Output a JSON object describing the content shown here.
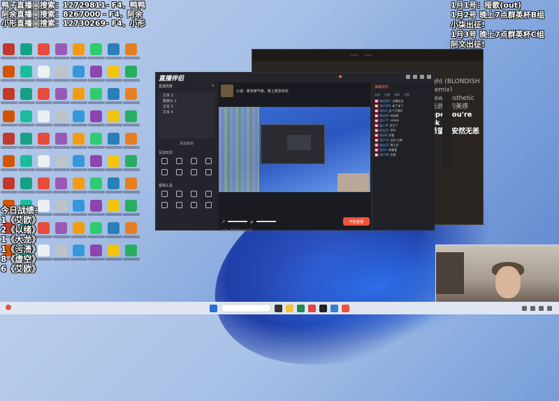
{
  "overlay_left": [
    "鸭子直播间搜索：12729811- F4、鸭鸭",
    "阿余直播间搜索：8267000 - F4、阿余",
    "小形直播间搜索：12730269- F4、小形"
  ],
  "overlay_right": [
    "1月1号：哑歌(out)",
    "1月2号 晚上7点群英杯B组",
    "小柒出征!",
    "1月3号 晚上7点群英杯C组",
    "阿文出征!"
  ],
  "score": {
    "title": "今日战绩：",
    "lines": [
      "1《艾欧》",
      "2《以绪》",
      "1《大龙》",
      "1《污渍》",
      "8《虚空》",
      "6《艾欧》"
    ]
  },
  "colors": {
    "accent": "#f0533a",
    "desktop_bg": "#a7c0e6",
    "app_bg": "#1f2026"
  },
  "app": {
    "logo": "直播伴侣",
    "stream_title": "小说：新年新气象，新上新衣的年",
    "go_live": "开始直播",
    "scene_header": "直播场景",
    "scene_items": [
      "文本 2",
      "摄像头 1",
      "文本 3",
      "文本 4"
    ],
    "add_source": "添加素材",
    "tool_sections": [
      "互动玩法",
      "基础工具"
    ],
    "chat_tabs": [
      "弹幕助手"
    ],
    "chat_sub": [
      "全部",
      "礼物",
      "进场",
      "点赞"
    ],
    "bottom_text": "主播：直播状态检测正常"
  },
  "music": {
    "song": "ight (BLONDISH Remix)",
    "lyrics": [
      "new aesthetic",
      "话说我的美感",
      "ope you're ok",
      "希望你安然无恙"
    ]
  },
  "chat_messages": [
    {
      "name": "粉丝001",
      "text": "主播加油"
    },
    {
      "name": "用户202",
      "text": "来了来了"
    },
    {
      "name": "观众A",
      "text": "这个打得好"
    },
    {
      "name": "粉丝09",
      "text": "哈哈哈"
    },
    {
      "name": "用户77",
      "text": "冲冲冲"
    },
    {
      "name": "路人甲",
      "text": "关注了"
    },
    {
      "name": "粉丝12",
      "text": "666"
    },
    {
      "name": "观众B",
      "text": "好看"
    },
    {
      "name": "用户55",
      "text": "送出 礼物"
    },
    {
      "name": "粉丝33",
      "text": "晚上好"
    },
    {
      "name": "观众C",
      "text": "来看看"
    },
    {
      "name": "用户09",
      "text": "厉害"
    }
  ]
}
